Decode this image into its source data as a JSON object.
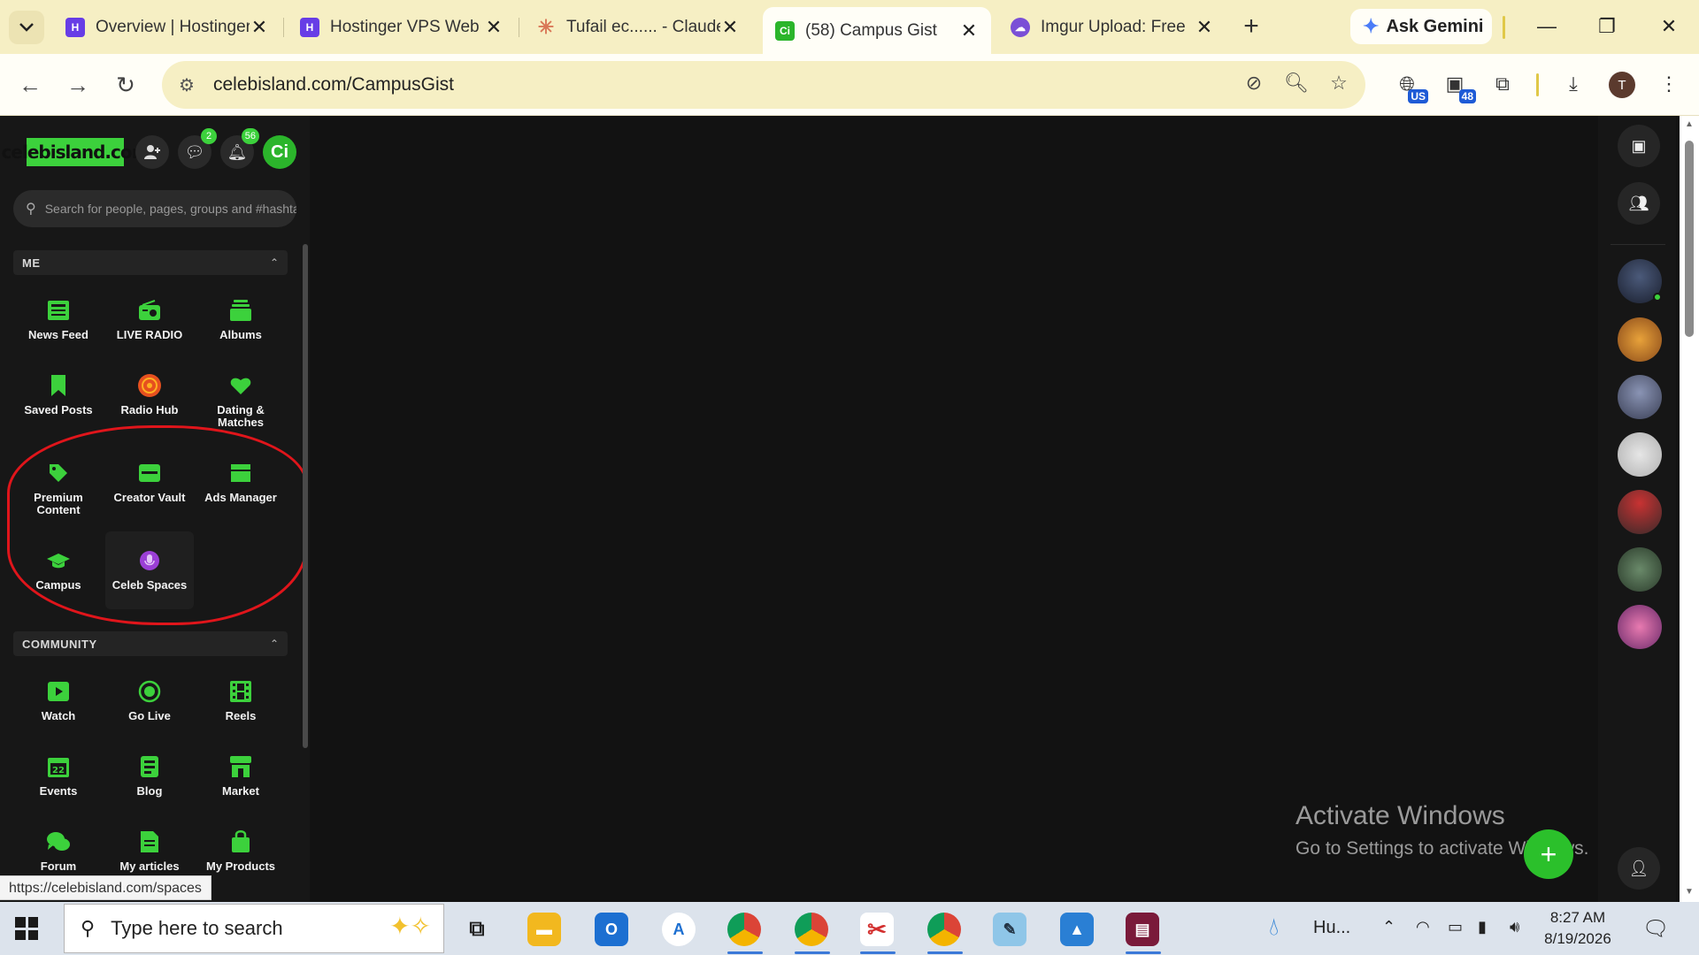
{
  "browser": {
    "tabs": [
      {
        "title": "Overview | Hostinger",
        "favicon": "hostinger-icon",
        "color": "#673de6"
      },
      {
        "title": "Hostinger VPS Web",
        "favicon": "hostinger-icon",
        "color": "#673de6"
      },
      {
        "title": "Tufail ec...... - Claude",
        "favicon": "claude-icon",
        "color": "#d97757"
      },
      {
        "title": "(58) Campus Gist",
        "favicon": "celebisland-icon",
        "color": "#2bb52b",
        "active": true
      },
      {
        "title": "Imgur Upload: Free",
        "favicon": "imgur-icon",
        "color": "#7a4fd6"
      }
    ],
    "gemini_label": "Ask Gemini",
    "url": "celebisland.com/CampusGist",
    "profile_initial": "T",
    "ext_badge_us": "US",
    "ext_badge_count": "48"
  },
  "site": {
    "logo": "celebisland.com",
    "messages_badge": "2",
    "notifications_badge": "56",
    "avatar_initials": "Ci",
    "search_placeholder": "Search for people, pages, groups and #hashtags"
  },
  "sections": {
    "me": {
      "label": "ME",
      "items": [
        {
          "label": "News Feed",
          "icon": "newspaper-icon"
        },
        {
          "label": "LIVE RADIO",
          "icon": "radio-icon"
        },
        {
          "label": "Albums",
          "icon": "albums-icon"
        },
        {
          "label": "Saved Posts",
          "icon": "bookmark-icon"
        },
        {
          "label": "Radio Hub",
          "icon": "radio-hub-icon"
        },
        {
          "label": "Dating & Matches",
          "icon": "heart-icon"
        },
        {
          "label": "Premium Content",
          "icon": "tag-icon"
        },
        {
          "label": "Creator Vault",
          "icon": "vault-icon"
        },
        {
          "label": "Ads Manager",
          "icon": "ads-icon"
        },
        {
          "label": "Campus",
          "icon": "graduation-cap-icon"
        },
        {
          "label": "Celeb Spaces",
          "icon": "microphone-icon"
        }
      ]
    },
    "community": {
      "label": "COMMUNITY",
      "items": [
        {
          "label": "Watch",
          "icon": "play-icon"
        },
        {
          "label": "Go Live",
          "icon": "live-icon"
        },
        {
          "label": "Reels",
          "icon": "film-icon"
        },
        {
          "label": "Events",
          "icon": "calendar-icon"
        },
        {
          "label": "Blog",
          "icon": "blog-icon"
        },
        {
          "label": "Market",
          "icon": "store-icon"
        },
        {
          "label": "Forum",
          "icon": "chat-bubbles-icon"
        },
        {
          "label": "My articles",
          "icon": "article-icon"
        },
        {
          "label": "My Products",
          "icon": "shopping-bag-icon"
        }
      ]
    }
  },
  "watermark": {
    "line1": "Activate Windows",
    "line2": "Go to Settings to activate Windows."
  },
  "status_url": "https://celebisland.com/spaces",
  "taskbar": {
    "search_placeholder": "Type here to search",
    "weather": "Hu...",
    "time": "8:27 AM",
    "date": "8/19/2026"
  },
  "colors": {
    "accent": "#3cd13c",
    "annotation": "#e0151b",
    "celeb_spaces": "#9b3fd6",
    "radio_hub": "#e6501f"
  }
}
